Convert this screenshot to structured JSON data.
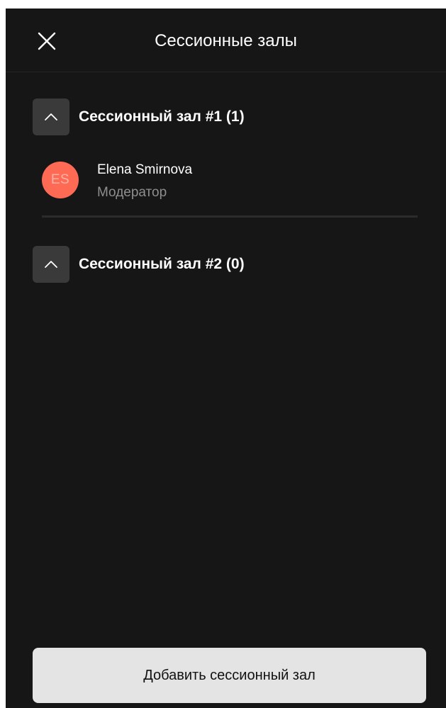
{
  "header": {
    "title": "Сессионные залы",
    "close_icon": "close-icon"
  },
  "rooms": [
    {
      "title": "Сессионный зал #1 (1)",
      "toggle_icon": "chevron-up-icon",
      "participants": [
        {
          "initials": "ES",
          "name": "Elena Smirnova",
          "role": "Модератор"
        }
      ]
    },
    {
      "title": "Сессионный зал #2 (0)",
      "toggle_icon": "chevron-up-icon",
      "participants": []
    }
  ],
  "footer": {
    "add_room_label": "Добавить сессионный зал"
  },
  "colors": {
    "background": "#161616",
    "avatar": "#ff6a55",
    "toggle_button": "#3a3a3a",
    "add_button": "#e4e4e4"
  }
}
